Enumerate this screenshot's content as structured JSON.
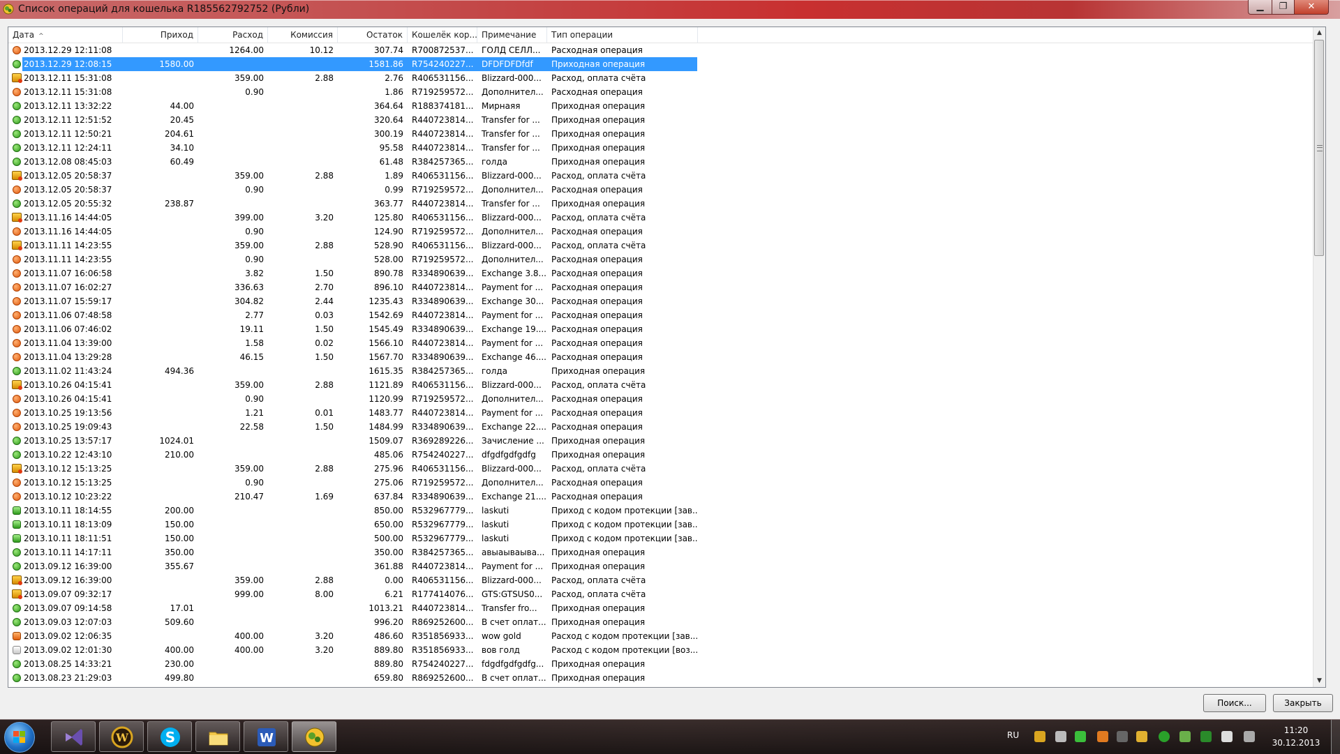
{
  "window": {
    "title": "Список операций для кошелька R185562792752 (Рубли)"
  },
  "columns": [
    "Дата",
    "Приход",
    "Расход",
    "Комиссия",
    "Остаток",
    "Кошелёк кор...",
    "Примечание",
    "Тип операции"
  ],
  "rows": [
    {
      "icon": "out",
      "date": "2013.12.29 12:11:08",
      "in": "",
      "out": "1264.00",
      "fee": "10.12",
      "bal": "307.74",
      "wallet": "R700872537...",
      "note": "ГОЛД СЕЛЛ...",
      "type": "Расходная операция"
    },
    {
      "icon": "in",
      "date": "2013.12.29 12:08:15",
      "in": "1580.00",
      "out": "",
      "fee": "",
      "bal": "1581.86",
      "wallet": "R754240227...",
      "note": "DFDFDFDfdf",
      "type": "Приходная операция",
      "selected": true
    },
    {
      "icon": "bill",
      "date": "2013.12.11 15:31:08",
      "in": "",
      "out": "359.00",
      "fee": "2.88",
      "bal": "2.76",
      "wallet": "R406531156...",
      "note": "Blizzard-000...",
      "type": "Расход, оплата счёта"
    },
    {
      "icon": "out",
      "date": "2013.12.11 15:31:08",
      "in": "",
      "out": "0.90",
      "fee": "",
      "bal": "1.86",
      "wallet": "R719259572...",
      "note": "Дополнител...",
      "type": "Расходная операция"
    },
    {
      "icon": "in",
      "date": "2013.12.11 13:32:22",
      "in": "44.00",
      "out": "",
      "fee": "",
      "bal": "364.64",
      "wallet": "R188374181...",
      "note": "Мирнаяя",
      "type": "Приходная операция"
    },
    {
      "icon": "in",
      "date": "2013.12.11 12:51:52",
      "in": "20.45",
      "out": "",
      "fee": "",
      "bal": "320.64",
      "wallet": "R440723814...",
      "note": "Transfer for ...",
      "type": "Приходная операция"
    },
    {
      "icon": "in",
      "date": "2013.12.11 12:50:21",
      "in": "204.61",
      "out": "",
      "fee": "",
      "bal": "300.19",
      "wallet": "R440723814...",
      "note": "Transfer for ...",
      "type": "Приходная операция"
    },
    {
      "icon": "in",
      "date": "2013.12.11 12:24:11",
      "in": "34.10",
      "out": "",
      "fee": "",
      "bal": "95.58",
      "wallet": "R440723814...",
      "note": "Transfer for ...",
      "type": "Приходная операция"
    },
    {
      "icon": "in",
      "date": "2013.12.08 08:45:03",
      "in": "60.49",
      "out": "",
      "fee": "",
      "bal": "61.48",
      "wallet": "R384257365...",
      "note": "голда",
      "type": "Приходная операция"
    },
    {
      "icon": "bill",
      "date": "2013.12.05 20:58:37",
      "in": "",
      "out": "359.00",
      "fee": "2.88",
      "bal": "1.89",
      "wallet": "R406531156...",
      "note": "Blizzard-000...",
      "type": "Расход, оплата счёта"
    },
    {
      "icon": "out",
      "date": "2013.12.05 20:58:37",
      "in": "",
      "out": "0.90",
      "fee": "",
      "bal": "0.99",
      "wallet": "R719259572...",
      "note": "Дополнител...",
      "type": "Расходная операция"
    },
    {
      "icon": "in",
      "date": "2013.12.05 20:55:32",
      "in": "238.87",
      "out": "",
      "fee": "",
      "bal": "363.77",
      "wallet": "R440723814...",
      "note": "Transfer for ...",
      "type": "Приходная операция"
    },
    {
      "icon": "bill",
      "date": "2013.11.16 14:44:05",
      "in": "",
      "out": "399.00",
      "fee": "3.20",
      "bal": "125.80",
      "wallet": "R406531156...",
      "note": "Blizzard-000...",
      "type": "Расход, оплата счёта"
    },
    {
      "icon": "out",
      "date": "2013.11.16 14:44:05",
      "in": "",
      "out": "0.90",
      "fee": "",
      "bal": "124.90",
      "wallet": "R719259572...",
      "note": "Дополнител...",
      "type": "Расходная операция"
    },
    {
      "icon": "bill",
      "date": "2013.11.11 14:23:55",
      "in": "",
      "out": "359.00",
      "fee": "2.88",
      "bal": "528.90",
      "wallet": "R406531156...",
      "note": "Blizzard-000...",
      "type": "Расход, оплата счёта"
    },
    {
      "icon": "out",
      "date": "2013.11.11 14:23:55",
      "in": "",
      "out": "0.90",
      "fee": "",
      "bal": "528.00",
      "wallet": "R719259572...",
      "note": "Дополнител...",
      "type": "Расходная операция"
    },
    {
      "icon": "out",
      "date": "2013.11.07 16:06:58",
      "in": "",
      "out": "3.82",
      "fee": "1.50",
      "bal": "890.78",
      "wallet": "R334890639...",
      "note": "Exchange 3.8...",
      "type": "Расходная операция"
    },
    {
      "icon": "out",
      "date": "2013.11.07 16:02:27",
      "in": "",
      "out": "336.63",
      "fee": "2.70",
      "bal": "896.10",
      "wallet": "R440723814...",
      "note": "Payment for ...",
      "type": "Расходная операция"
    },
    {
      "icon": "out",
      "date": "2013.11.07 15:59:17",
      "in": "",
      "out": "304.82",
      "fee": "2.44",
      "bal": "1235.43",
      "wallet": "R334890639...",
      "note": "Exchange 30...",
      "type": "Расходная операция"
    },
    {
      "icon": "out",
      "date": "2013.11.06 07:48:58",
      "in": "",
      "out": "2.77",
      "fee": "0.03",
      "bal": "1542.69",
      "wallet": "R440723814...",
      "note": "Payment for ...",
      "type": "Расходная операция"
    },
    {
      "icon": "out",
      "date": "2013.11.06 07:46:02",
      "in": "",
      "out": "19.11",
      "fee": "1.50",
      "bal": "1545.49",
      "wallet": "R334890639...",
      "note": "Exchange 19....",
      "type": "Расходная операция"
    },
    {
      "icon": "out",
      "date": "2013.11.04 13:39:00",
      "in": "",
      "out": "1.58",
      "fee": "0.02",
      "bal": "1566.10",
      "wallet": "R440723814...",
      "note": "Payment for ...",
      "type": "Расходная операция"
    },
    {
      "icon": "out",
      "date": "2013.11.04 13:29:28",
      "in": "",
      "out": "46.15",
      "fee": "1.50",
      "bal": "1567.70",
      "wallet": "R334890639...",
      "note": "Exchange 46....",
      "type": "Расходная операция"
    },
    {
      "icon": "in",
      "date": "2013.11.02 11:43:24",
      "in": "494.36",
      "out": "",
      "fee": "",
      "bal": "1615.35",
      "wallet": "R384257365...",
      "note": "голда",
      "type": "Приходная операция"
    },
    {
      "icon": "bill",
      "date": "2013.10.26 04:15:41",
      "in": "",
      "out": "359.00",
      "fee": "2.88",
      "bal": "1121.89",
      "wallet": "R406531156...",
      "note": "Blizzard-000...",
      "type": "Расход, оплата счёта"
    },
    {
      "icon": "out",
      "date": "2013.10.26 04:15:41",
      "in": "",
      "out": "0.90",
      "fee": "",
      "bal": "1120.99",
      "wallet": "R719259572...",
      "note": "Дополнител...",
      "type": "Расходная операция"
    },
    {
      "icon": "out",
      "date": "2013.10.25 19:13:56",
      "in": "",
      "out": "1.21",
      "fee": "0.01",
      "bal": "1483.77",
      "wallet": "R440723814...",
      "note": "Payment for ...",
      "type": "Расходная операция"
    },
    {
      "icon": "out",
      "date": "2013.10.25 19:09:43",
      "in": "",
      "out": "22.58",
      "fee": "1.50",
      "bal": "1484.99",
      "wallet": "R334890639...",
      "note": "Exchange 22....",
      "type": "Расходная операция"
    },
    {
      "icon": "in",
      "date": "2013.10.25 13:57:17",
      "in": "1024.01",
      "out": "",
      "fee": "",
      "bal": "1509.07",
      "wallet": "R369289226...",
      "note": "Зачисление ...",
      "type": "Приходная операция"
    },
    {
      "icon": "in",
      "date": "2013.10.22 12:43:10",
      "in": "210.00",
      "out": "",
      "fee": "",
      "bal": "485.06",
      "wallet": "R754240227...",
      "note": "dfgdfgdfgdfg",
      "type": "Приходная операция"
    },
    {
      "icon": "bill",
      "date": "2013.10.12 15:13:25",
      "in": "",
      "out": "359.00",
      "fee": "2.88",
      "bal": "275.96",
      "wallet": "R406531156...",
      "note": "Blizzard-000...",
      "type": "Расход, оплата счёта"
    },
    {
      "icon": "out",
      "date": "2013.10.12 15:13:25",
      "in": "",
      "out": "0.90",
      "fee": "",
      "bal": "275.06",
      "wallet": "R719259572...",
      "note": "Дополнител...",
      "type": "Расходная операция"
    },
    {
      "icon": "out",
      "date": "2013.10.12 10:23:22",
      "in": "",
      "out": "210.47",
      "fee": "1.69",
      "bal": "637.84",
      "wallet": "R334890639...",
      "note": "Exchange 21....",
      "type": "Расходная операция"
    },
    {
      "icon": "prot",
      "date": "2013.10.11 18:14:55",
      "in": "200.00",
      "out": "",
      "fee": "",
      "bal": "850.00",
      "wallet": "R532967779...",
      "note": "laskuti",
      "type": "Приход с кодом протекции [зав..."
    },
    {
      "icon": "prot",
      "date": "2013.10.11 18:13:09",
      "in": "150.00",
      "out": "",
      "fee": "",
      "bal": "650.00",
      "wallet": "R532967779...",
      "note": "laskuti",
      "type": "Приход с кодом протекции [зав..."
    },
    {
      "icon": "prot",
      "date": "2013.10.11 18:11:51",
      "in": "150.00",
      "out": "",
      "fee": "",
      "bal": "500.00",
      "wallet": "R532967779...",
      "note": "laskuti",
      "type": "Приход с кодом протекции [зав..."
    },
    {
      "icon": "in",
      "date": "2013.10.11 14:17:11",
      "in": "350.00",
      "out": "",
      "fee": "",
      "bal": "350.00",
      "wallet": "R384257365...",
      "note": "авыаываыва...",
      "type": "Приходная операция"
    },
    {
      "icon": "in",
      "date": "2013.09.12 16:39:00",
      "in": "355.67",
      "out": "",
      "fee": "",
      "bal": "361.88",
      "wallet": "R440723814...",
      "note": "Payment for ...",
      "type": "Приходная операция"
    },
    {
      "icon": "bill",
      "date": "2013.09.12 16:39:00",
      "in": "",
      "out": "359.00",
      "fee": "2.88",
      "bal": "0.00",
      "wallet": "R406531156...",
      "note": "Blizzard-000...",
      "type": "Расход, оплата счёта"
    },
    {
      "icon": "bill",
      "date": "2013.09.07 09:32:17",
      "in": "",
      "out": "999.00",
      "fee": "8.00",
      "bal": "6.21",
      "wallet": "R177414076...",
      "note": "GTS:GTSUS0...",
      "type": "Расход, оплата счёта"
    },
    {
      "icon": "in",
      "date": "2013.09.07 09:14:58",
      "in": "17.01",
      "out": "",
      "fee": "",
      "bal": "1013.21",
      "wallet": "R440723814...",
      "note": "Transfer fro...",
      "type": "Приходная операция"
    },
    {
      "icon": "in",
      "date": "2013.09.03 12:07:03",
      "in": "509.60",
      "out": "",
      "fee": "",
      "bal": "996.20",
      "wallet": "R869252600...",
      "note": "В счет оплат...",
      "type": "Приходная операция"
    },
    {
      "icon": "protout",
      "date": "2013.09.02 12:06:35",
      "in": "",
      "out": "400.00",
      "fee": "3.20",
      "bal": "486.60",
      "wallet": "R351856933...",
      "note": "wow gold",
      "type": "Расход с кодом протекции [зав..."
    },
    {
      "icon": "protret",
      "date": "2013.09.02 12:01:30",
      "in": "400.00",
      "out": "400.00",
      "fee": "3.20",
      "bal": "889.80",
      "wallet": "R351856933...",
      "note": "вов голд",
      "type": "Расход с кодом протекции [воз..."
    },
    {
      "icon": "in",
      "date": "2013.08.25 14:33:21",
      "in": "230.00",
      "out": "",
      "fee": "",
      "bal": "889.80",
      "wallet": "R754240227...",
      "note": "fdgdfgdfgdfg...",
      "type": "Приходная операция"
    },
    {
      "icon": "in",
      "date": "2013.08.23 21:29:03",
      "in": "499.80",
      "out": "",
      "fee": "",
      "bal": "659.80",
      "wallet": "R869252600...",
      "note": "В счет оплат...",
      "type": "Приходная операция"
    }
  ],
  "buttons": {
    "search": "Поиск...",
    "close": "Закрыть"
  },
  "taskbar": {
    "apps": [
      "visual-studio",
      "world-of-warcraft",
      "skype",
      "file-explorer",
      "word",
      "webmoney-keeper"
    ],
    "lang": "RU",
    "time": "11:20",
    "date": "30.12.2013"
  }
}
